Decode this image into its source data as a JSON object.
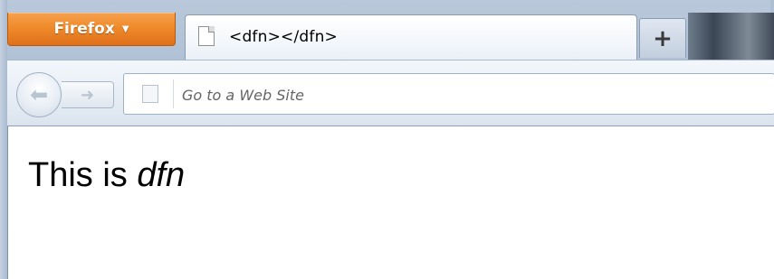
{
  "app": {
    "menu_button_label": "Firefox",
    "menu_button_caret": "▼"
  },
  "tabs": [
    {
      "title": "<dfn></dfn>",
      "favicon": "blank-page-icon"
    }
  ],
  "new_tab": {
    "label": "+"
  },
  "navigation": {
    "back_icon": "back-arrow-icon",
    "forward_icon": "forward-arrow-icon",
    "back_glyph": "⬅",
    "forward_glyph": "➜"
  },
  "address_bar": {
    "placeholder": "Go to a Web Site",
    "value": ""
  },
  "page": {
    "text_prefix": "This is ",
    "dfn_text": "dfn"
  },
  "colors": {
    "firefox_button": "#ef8b2a",
    "frame": "#b9c8da"
  }
}
